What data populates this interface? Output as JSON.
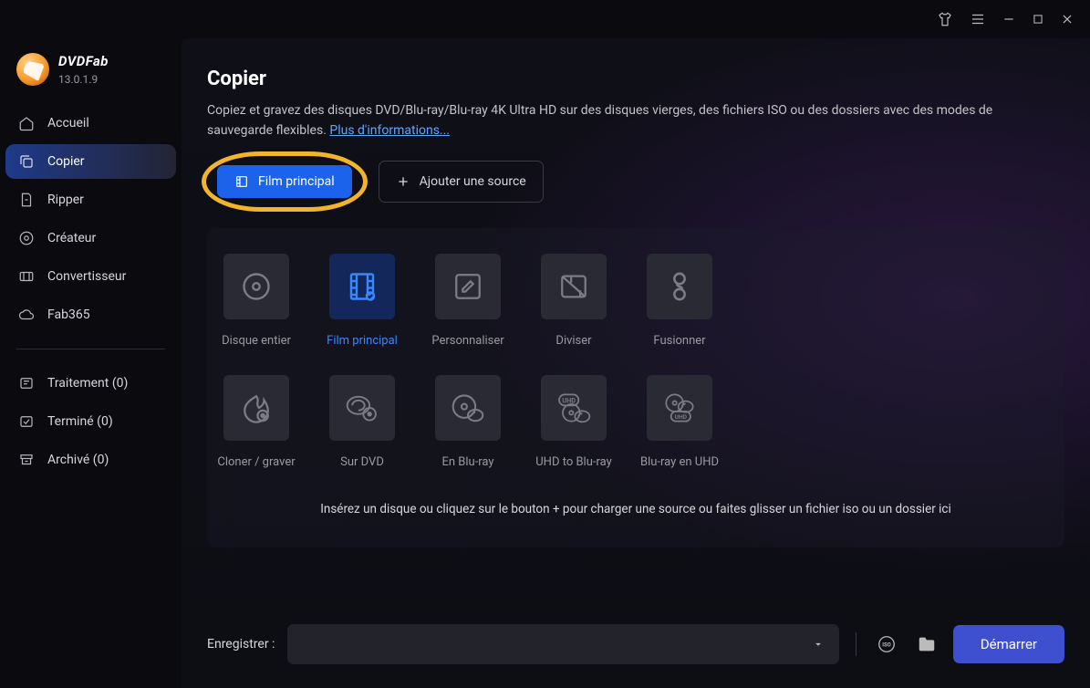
{
  "brand": {
    "name": "DVDFab",
    "version": "13.0.1.9"
  },
  "sidebar": {
    "items": [
      {
        "label": "Accueil"
      },
      {
        "label": "Copier"
      },
      {
        "label": "Ripper"
      },
      {
        "label": "Créateur"
      },
      {
        "label": "Convertisseur"
      },
      {
        "label": "Fab365"
      }
    ],
    "status_items": [
      {
        "label": "Traitement (0)"
      },
      {
        "label": "Terminé (0)"
      },
      {
        "label": "Archivé (0)"
      }
    ]
  },
  "page": {
    "title": "Copier",
    "description": "Copiez et gravez des disques DVD/Blu-ray/Blu-ray 4K Ultra HD sur des disques vierges, des fichiers ISO ou des dossiers avec des modes de sauvegarde flexibles. ",
    "more_link": "Plus d'informations..."
  },
  "buttons": {
    "film_principal": "Film principal",
    "add_source": "Ajouter une source"
  },
  "modes": [
    {
      "label": "Disque entier"
    },
    {
      "label": "Film principal"
    },
    {
      "label": "Personnaliser"
    },
    {
      "label": "Diviser"
    },
    {
      "label": "Fusionner"
    },
    {
      "label": "Cloner / graver"
    },
    {
      "label": "Sur DVD"
    },
    {
      "label": "En Blu-ray"
    },
    {
      "label": "UHD to Blu-ray"
    },
    {
      "label": "Blu-ray en UHD"
    }
  ],
  "hint": "Insérez un disque ou cliquez sur le bouton  +  pour charger une source ou faites glisser un fichier iso ou un dossier ici",
  "footer": {
    "save_label": "Enregistrer :",
    "start": "Démarrer"
  }
}
